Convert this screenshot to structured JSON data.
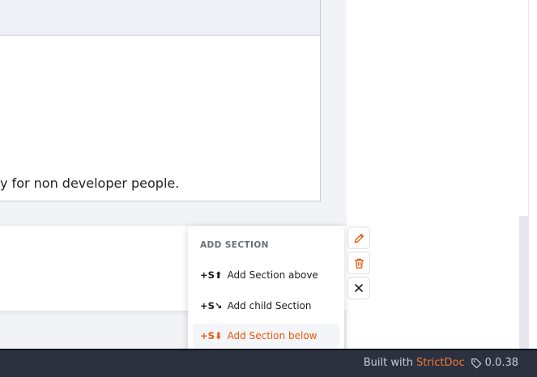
{
  "document": {
    "body_text": "y for non developer people."
  },
  "add_section_menu": {
    "title": "ADD SECTION",
    "items": [
      {
        "shortcut": "+S⬆",
        "label": "Add Section above"
      },
      {
        "shortcut": "+S↘",
        "label": "Add child Section"
      },
      {
        "shortcut": "+S⬇",
        "label": "Add Section below"
      }
    ],
    "active_index": 2
  },
  "node_actions": {
    "edit_icon": "pencil-icon",
    "delete_icon": "trash-icon",
    "close_icon": "close-icon",
    "accent": "#e8590c"
  },
  "footer": {
    "built_with": "Built with",
    "brand": "StrictDoc",
    "version": "0.0.38",
    "brand_color": "#f07a36"
  }
}
